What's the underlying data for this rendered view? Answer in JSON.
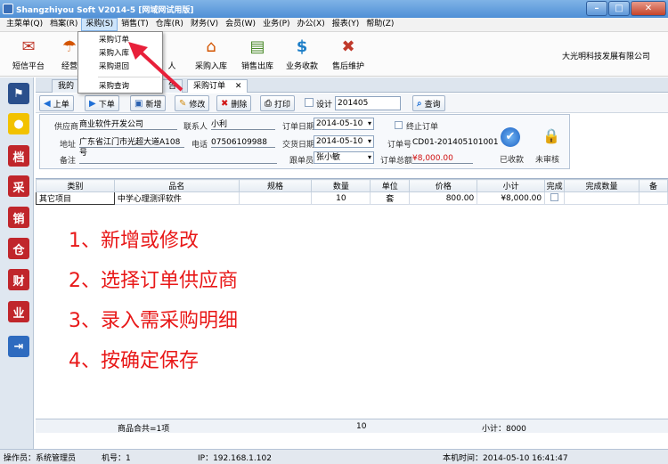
{
  "window": {
    "title": "Shangzhiyou Soft V2014-5 [网域网试用版]"
  },
  "menu": [
    "主菜单(Q)",
    "档案(R)",
    "采购(S)",
    "销售(T)",
    "仓库(R)",
    "财务(V)",
    "会员(W)",
    "业务(P)",
    "办公(X)",
    "报表(Y)",
    "帮助(Z)"
  ],
  "purchase_menu": [
    "采购订单",
    "采购入库",
    "采购退回",
    "采购查询"
  ],
  "toolbar": {
    "items": [
      "短信平台",
      "经营",
      "人",
      "采购入库",
      "销售出库",
      "业务收款",
      "售后维护"
    ],
    "company": "大光明科技发展有限公司"
  },
  "sidebar_icons": [
    "flag-icon",
    "bulb-icon",
    "archive-icon",
    "purchase-icon",
    "sales-icon",
    "warehouse-icon",
    "finance-icon",
    "business-icon",
    "exit-icon"
  ],
  "sidebar_chars": [
    "",
    "",
    "档",
    "采",
    "销",
    "仓",
    "财",
    "业",
    ""
  ],
  "tabs": [
    "我的",
    "告",
    "采购订单"
  ],
  "actions": {
    "prev": "上单",
    "next": "下单",
    "new": "新增",
    "edit": "修改",
    "delete": "删除",
    "print": "打印",
    "design_label": "设计",
    "search_value": "201405",
    "search": "查询"
  },
  "form": {
    "supplier_label": "供应商",
    "supplier": "商业软件开发公司",
    "contact_label": "联系人",
    "contact": "小利",
    "order_date_label": "订单日期",
    "order_date": "2014-05-10",
    "stop_label": "终止订单",
    "address_label": "地址",
    "address": "广东省江门市光超大道A108号",
    "phone_label": "电话",
    "phone": "07506109988",
    "delivery_label": "交货日期",
    "delivery_date": "2014-05-10",
    "order_no_label": "订单号",
    "order_no": "CD01-201405101001",
    "remark_label": "备注",
    "handler_label": "跟单员",
    "handler": "张小敏",
    "total_label": "订单总额",
    "total": "¥8,000.00",
    "paid_label": "已收款",
    "unaudit_label": "未审核"
  },
  "grid": {
    "headers": [
      "类别",
      "品名",
      "规格",
      "数量",
      "单位",
      "价格",
      "小计",
      "完成",
      "完成数量",
      "备"
    ],
    "rows": [
      {
        "category": "其它项目",
        "name": "中学心理测评软件",
        "spec": "",
        "qty": "10",
        "unit": "套",
        "price": "800.00",
        "subtotal": "¥8,000.00"
      }
    ]
  },
  "instructions": [
    "1、新增或修改",
    "2、选择订单供应商",
    "3、录入需采购明细",
    "4、按确定保存"
  ],
  "summary": {
    "items": "商品合共=1项",
    "qty": "10",
    "subtotal": "小计：8000"
  },
  "status": {
    "operator": "操作员：系统管理员",
    "machine": "机号：1",
    "ip": "IP：192.168.1.102",
    "time": "本机时间：2014-05-10 16:41:47"
  },
  "colors": {
    "accent": "#4f8fd6",
    "instruction": "#e81818",
    "arrow": "#e8203a"
  }
}
